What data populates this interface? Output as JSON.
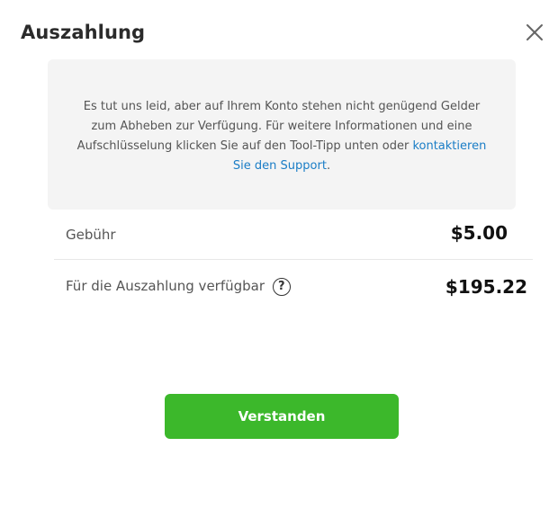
{
  "dialog": {
    "title": "Auszahlung",
    "close_icon": "close-icon"
  },
  "info": {
    "message": "Es tut uns leid, aber auf Ihrem Konto stehen nicht genügend Gelder zum Abheben zur Verfügung. Für weitere Informationen und eine Aufschlüsselung klicken Sie auf den Tool-Tipp unten oder",
    "link_text": "kontaktieren Sie den Support",
    "link_suffix": "."
  },
  "fee": {
    "label": "Gebühr",
    "value": "$5.00"
  },
  "available": {
    "label": "Für die Auszahlung verfügbar",
    "help_icon_glyph": "?",
    "help_icon": "help-icon",
    "value": "$195.22"
  },
  "actions": {
    "confirm_label": "Verstanden"
  },
  "colors": {
    "accent_green": "#3cb82b",
    "link_blue": "#1a7dc6",
    "info_bg": "#f4f4f4"
  }
}
